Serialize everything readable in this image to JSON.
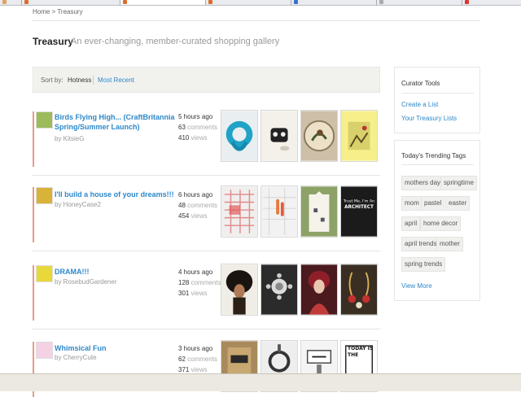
{
  "breadcrumb": "Home > Treasury",
  "header": {
    "title": "Treasury",
    "subtitle": "An ever-changing, member-curated shopping gallery"
  },
  "sort": {
    "label": "Sort by:",
    "options": [
      "Hotness",
      "Most Recent"
    ],
    "selected": "Hotness"
  },
  "lists": [
    {
      "title": "Birds Flying High... (CraftBritannia Spring/Summer Launch)",
      "curator": "by KitsieG",
      "time": "5 hours ago",
      "comments": "63",
      "views": "410"
    },
    {
      "title": "I'll build a house of your dreams!!!",
      "curator": "by HoneyCase2",
      "time": "6 hours ago",
      "comments": "48",
      "views": "454"
    },
    {
      "title": "DRAMA!!!",
      "curator": "by RosebudGardener",
      "time": "4 hours ago",
      "comments": "128",
      "views": "301"
    },
    {
      "title": "Whimsical Fun",
      "curator": "by CherryCute",
      "time": "3 hours ago",
      "comments": "62",
      "views": "371"
    }
  ],
  "labels": {
    "comments": "comments",
    "views": "views"
  },
  "curator_tools": {
    "title": "Curator Tools",
    "links": [
      "Create a List",
      "Your Treasury Lists"
    ]
  },
  "trending": {
    "title": "Today's Trending Tags",
    "tags": [
      "mothers day",
      "springtime",
      "mom",
      "pastel",
      "easter",
      "april",
      "home decor",
      "april trends",
      "mother",
      "spring trends"
    ],
    "more": "View More"
  },
  "thumb_texts": {
    "architect": "Trust Me, I'm An ARCHITECT",
    "today": "TODAY IS THE"
  },
  "colors": {
    "link": "#2e88c9",
    "accent": "#e89a88",
    "sortbar": "#f1f1ee"
  }
}
